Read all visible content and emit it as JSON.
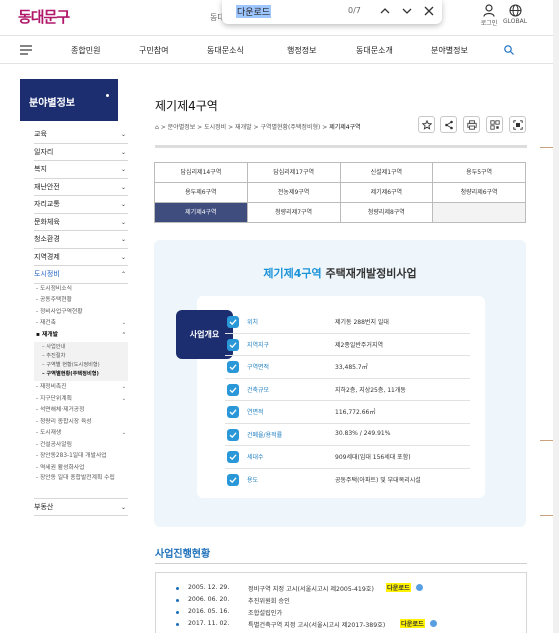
{
  "header": {
    "logo": "동대문구",
    "cut_text": "동대",
    "login": "로그인",
    "global": "GLOBAL"
  },
  "findbar": {
    "query": "다운로드",
    "count": "0/7"
  },
  "gnb": {
    "items": [
      "종합민원",
      "구민참여",
      "동대문소식",
      "행정정보",
      "동대문소개",
      "분야별정보"
    ]
  },
  "sidebar": {
    "title": "분야별정보",
    "categories": [
      {
        "label": "교육"
      },
      {
        "label": "일자리"
      },
      {
        "label": "복지"
      },
      {
        "label": "재난안전"
      },
      {
        "label": "자리교통"
      },
      {
        "label": "문화체육"
      },
      {
        "label": "청소환경"
      },
      {
        "label": "지역경제"
      },
      {
        "label": "도시정비"
      }
    ],
    "subs_top": [
      "도시정비소식",
      "공동주택현황",
      "정비사업구역현황"
    ],
    "sub_reconstruction": "재건축",
    "sub_redevelopment": "재개발",
    "subsub": [
      "사업안내",
      "추진절차",
      "구역별 현황(도시정비형)",
      "구역별현황(주택정비형)"
    ],
    "subs_bottom": [
      "재정비촉진",
      "지구단위계획",
      "석면해체·제거공정",
      "청량리 종합시장 육성",
      "도시재생",
      "건설공사알림",
      "장안동283-1일대 개발사업",
      "역세권 활성화사업",
      "장안동 일대 종합발전계획 수립"
    ],
    "last_category": "부동산"
  },
  "page": {
    "title": "제기제4구역",
    "breadcrumb": [
      "분야별정보",
      "도시정비",
      "재개발",
      "구역별현황(주택정비형)",
      "제기제4구역"
    ]
  },
  "zones": [
    [
      "답십리제14구역",
      "답십리제17구역",
      "신설제1구역",
      "용두5구역"
    ],
    [
      "용두제6구역",
      "전농제9구역",
      "제기제6구역",
      "청량리제6구역"
    ],
    [
      "제기제4구역",
      "청량리제7구역",
      "청량리제8구역",
      ""
    ]
  ],
  "active_zone": "제기제4구역",
  "overview": {
    "title_highlight": "제기제4구역",
    "title_rest": " 주택재개발정비사업",
    "badge": "사업개요",
    "rows": [
      {
        "label": "위치",
        "value": "제기동 288번지 일대"
      },
      {
        "label": "지역지구",
        "value": "제2종일반주거지역"
      },
      {
        "label": "구역면적",
        "value": "33,485.7㎡"
      },
      {
        "label": "건축규모",
        "value": "지하2층, 지상25층, 11개동"
      },
      {
        "label": "연면적",
        "value": "116,772.66㎡"
      },
      {
        "label": "건폐율/용적률",
        "value": "30.83% / 249.91%"
      },
      {
        "label": "세대수",
        "value": "909세대(임대 156세대 포함)"
      },
      {
        "label": "용도",
        "value": "공동주택(아파트) 및 부대복리시설"
      }
    ]
  },
  "progress": {
    "title": "사업진행현황",
    "rows": [
      {
        "date": "2005. 12. 29.",
        "text": "정비구역 지정 고시(서울시고시 제2005-419호)",
        "download": "다운로드"
      },
      {
        "date": "2006. 06. 20.",
        "text": "추진위원회 승인",
        "download": ""
      },
      {
        "date": "2016. 05. 16.",
        "text": "조합설립인가",
        "download": ""
      },
      {
        "date": "2017. 11. 02.",
        "text": "특별건축구역 지정 고시(서울시고시 제2017-389호)",
        "download": "다운로드"
      }
    ]
  },
  "colors": {
    "navy": "#1c2e70",
    "accent_blue": "#1a93d8",
    "brand_magenta": "#b0176a",
    "highlight": "#fff200"
  }
}
